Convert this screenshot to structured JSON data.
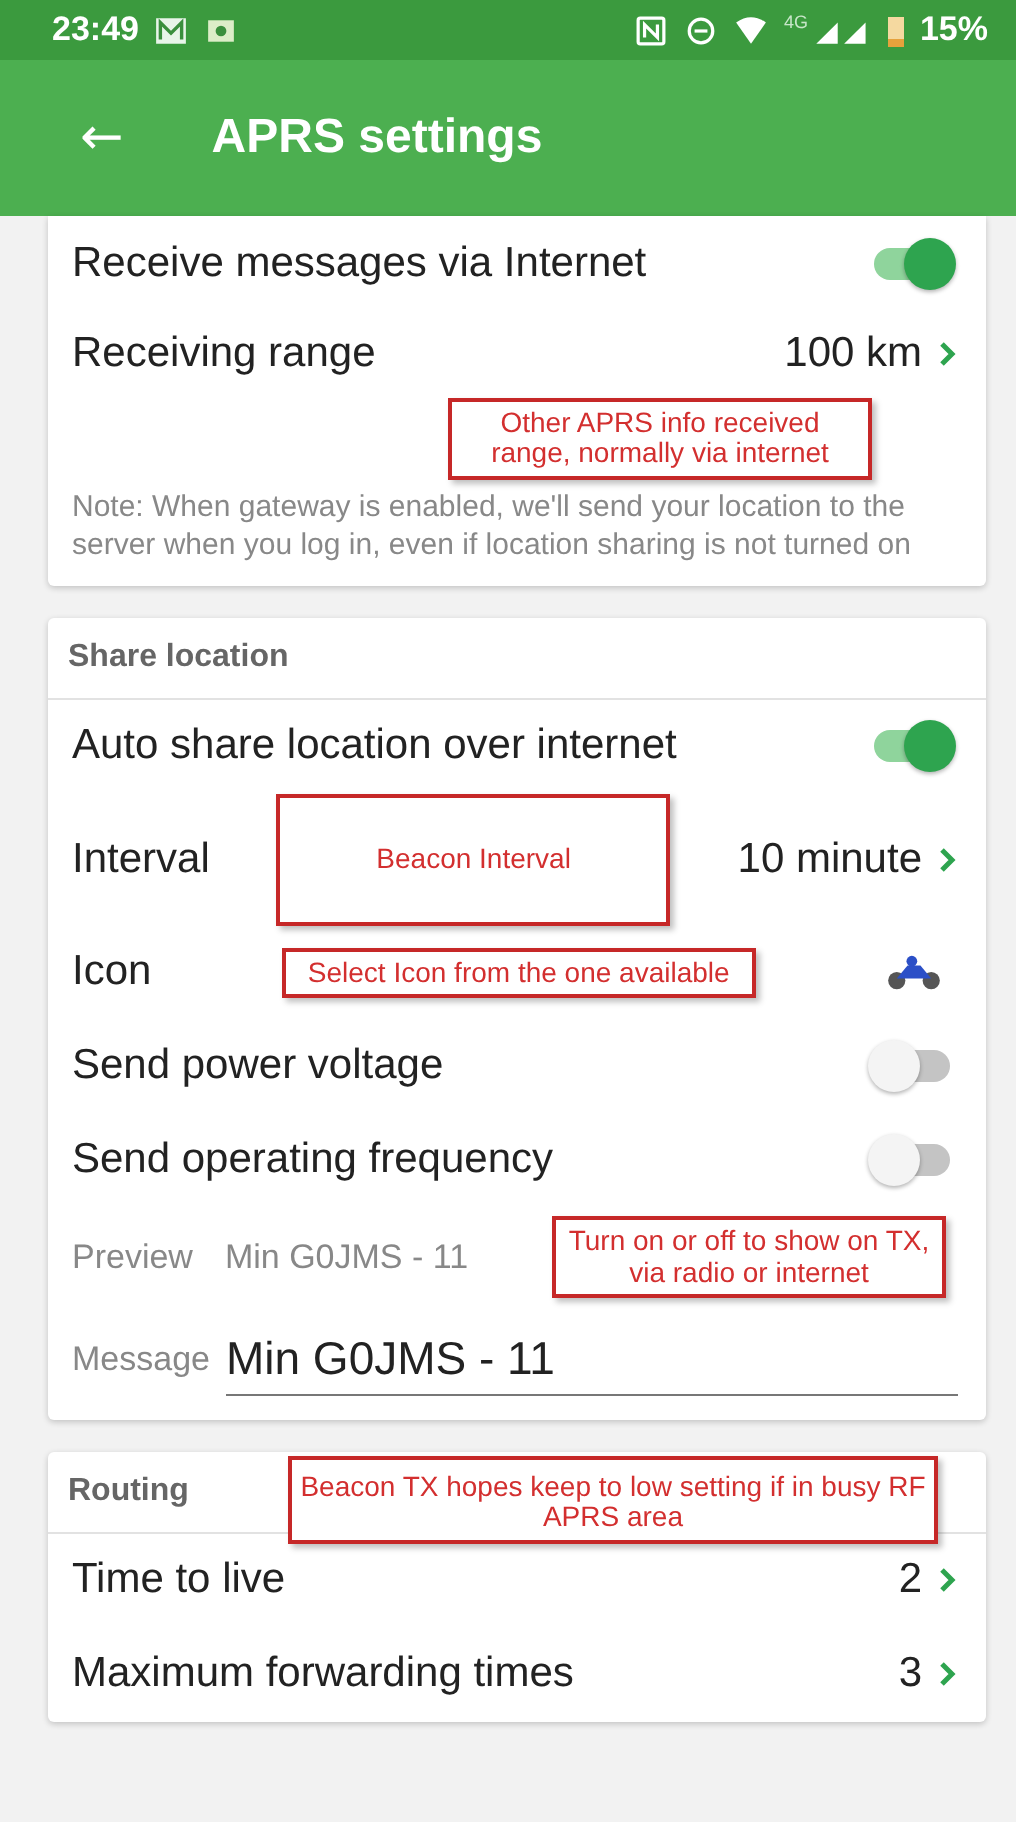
{
  "status_bar": {
    "time": "23:49",
    "network": "4G",
    "battery": "15%"
  },
  "app_bar": {
    "back": "←",
    "title": "APRS settings"
  },
  "sections": [
    {
      "items": [
        {
          "kind": "switch",
          "label": "Receive messages via Internet",
          "on": true
        },
        {
          "kind": "value",
          "label": "Receiving range",
          "value": "100 km",
          "annotation": "Other APRS info received range, normally via internet"
        }
      ],
      "note": "Note: When gateway is enabled, we'll send your location to the server when you log in, even if location sharing is not turned on"
    },
    {
      "header": "Share location",
      "items": [
        {
          "kind": "switch",
          "label": "Auto share location over internet",
          "on": true
        },
        {
          "kind": "value",
          "label": "Interval",
          "value": "10 minute",
          "annotation": "Beacon Interval"
        },
        {
          "kind": "icon",
          "label": "Icon",
          "annotation": "Select Icon from the one available"
        },
        {
          "kind": "switch",
          "label": "Send power voltage",
          "on": false
        },
        {
          "kind": "switch",
          "label": "Send operating frequency",
          "on": false
        },
        {
          "kind": "preview",
          "label": "Preview",
          "value": "Min G0JMS - 11",
          "annotation": "Turn on or off to show on TX, via radio or internet"
        },
        {
          "kind": "field",
          "label": "Message",
          "value": "Min G0JMS - 11"
        }
      ]
    },
    {
      "header": "Routing",
      "header_annotation": "Beacon TX hopes keep to low setting if in busy RF APRS area",
      "items": [
        {
          "kind": "value",
          "label": "Time to live",
          "value": "2"
        },
        {
          "kind": "value",
          "label": "Maximum forwarding times",
          "value": "3"
        }
      ]
    }
  ]
}
